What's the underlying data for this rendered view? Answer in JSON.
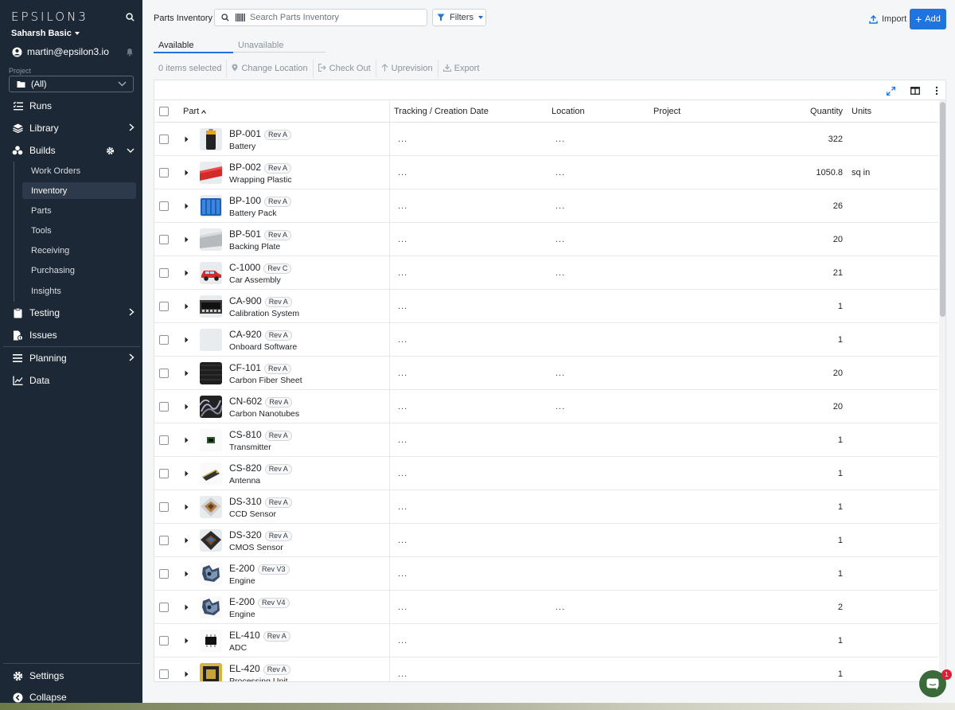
{
  "sidebar": {
    "logo": "EPSILON3",
    "org": "Saharsh Basic",
    "email": "martin@epsilon3.io",
    "project_label": "Project",
    "project_value": "(All)",
    "nav": {
      "runs": "Runs",
      "library": "Library",
      "builds": "Builds",
      "testing": "Testing",
      "issues": "Issues",
      "planning": "Planning",
      "data": "Data",
      "settings": "Settings",
      "collapse": "Collapse"
    },
    "builds_items": [
      "Work Orders",
      "Inventory",
      "Parts",
      "Tools",
      "Receiving",
      "Purchasing",
      "Insights"
    ],
    "active_builds_item": "Inventory"
  },
  "header": {
    "title": "Parts Inventory",
    "search_placeholder": "Search Parts Inventory",
    "filters": "Filters",
    "import": "Import",
    "add": "Add"
  },
  "tabs": {
    "available": "Available",
    "unavailable": "Unavailable"
  },
  "toolbar": {
    "selected": "0 items selected",
    "change_location": "Change Location",
    "check_out": "Check Out",
    "uprevision": "Uprevision",
    "export": "Export"
  },
  "table": {
    "columns": {
      "part": "Part",
      "tracking": "Tracking / Creation Date",
      "location": "Location",
      "project": "Project",
      "quantity": "Quantity",
      "units": "Units"
    },
    "rows": [
      {
        "part": "BP-001",
        "rev": "Rev A",
        "name": "Battery",
        "tracking": "...",
        "location": "...",
        "quantity": "322",
        "units": "",
        "thumb": "battery"
      },
      {
        "part": "BP-002",
        "rev": "Rev A",
        "name": "Wrapping Plastic",
        "tracking": "...",
        "location": "...",
        "quantity": "1050.8",
        "units": "sq in",
        "thumb": "plastic"
      },
      {
        "part": "BP-100",
        "rev": "Rev A",
        "name": "Battery Pack",
        "tracking": "...",
        "location": "...",
        "quantity": "26",
        "units": "",
        "thumb": "pack"
      },
      {
        "part": "BP-501",
        "rev": "Rev A",
        "name": "Backing Plate",
        "tracking": "...",
        "location": "...",
        "quantity": "20",
        "units": "",
        "thumb": "plate"
      },
      {
        "part": "C-1000",
        "rev": "Rev C",
        "name": "Car Assembly",
        "tracking": "...",
        "location": "...",
        "quantity": "21",
        "units": "",
        "thumb": "car"
      },
      {
        "part": "CA-900",
        "rev": "Rev A",
        "name": "Calibration System",
        "tracking": "...",
        "location": "",
        "quantity": "1",
        "units": "",
        "thumb": "chip"
      },
      {
        "part": "CA-920",
        "rev": "Rev A",
        "name": "Onboard Software",
        "tracking": "...",
        "location": "",
        "quantity": "1",
        "units": "",
        "thumb": "blank"
      },
      {
        "part": "CF-101",
        "rev": "Rev A",
        "name": "Carbon Fiber Sheet",
        "tracking": "...",
        "location": "...",
        "quantity": "20",
        "units": "",
        "thumb": "carbon"
      },
      {
        "part": "CN-602",
        "rev": "Rev A",
        "name": "Carbon Nanotubes",
        "tracking": "...",
        "location": "...",
        "quantity": "20",
        "units": "",
        "thumb": "nano"
      },
      {
        "part": "CS-810",
        "rev": "Rev A",
        "name": "Transmitter",
        "tracking": "...",
        "location": "",
        "quantity": "1",
        "units": "",
        "thumb": "tx"
      },
      {
        "part": "CS-820",
        "rev": "Rev A",
        "name": "Antenna",
        "tracking": "...",
        "location": "",
        "quantity": "1",
        "units": "",
        "thumb": "antenna"
      },
      {
        "part": "DS-310",
        "rev": "Rev A",
        "name": "CCD Sensor",
        "tracking": "...",
        "location": "",
        "quantity": "1",
        "units": "",
        "thumb": "ccd"
      },
      {
        "part": "DS-320",
        "rev": "Rev A",
        "name": "CMOS Sensor",
        "tracking": "...",
        "location": "",
        "quantity": "1",
        "units": "",
        "thumb": "cmos"
      },
      {
        "part": "E-200",
        "rev": "Rev V3",
        "name": "Engine",
        "tracking": "...",
        "location": "",
        "quantity": "1",
        "units": "",
        "thumb": "engine"
      },
      {
        "part": "E-200",
        "rev": "Rev V4",
        "name": "Engine",
        "tracking": "...",
        "location": "...",
        "quantity": "2",
        "units": "",
        "thumb": "engine"
      },
      {
        "part": "EL-410",
        "rev": "Rev A",
        "name": "ADC",
        "tracking": "...",
        "location": "",
        "quantity": "1",
        "units": "",
        "thumb": "adc"
      },
      {
        "part": "EL-420",
        "rev": "Rev A",
        "name": "Processing Unit",
        "tracking": "...",
        "location": "",
        "quantity": "1",
        "units": "",
        "thumb": "cpu"
      }
    ]
  },
  "chat": {
    "badge": "1"
  },
  "colors": {
    "sidebar": "#1c2836",
    "accent": "#1f74e0",
    "active_item": "#2d3a4b"
  }
}
